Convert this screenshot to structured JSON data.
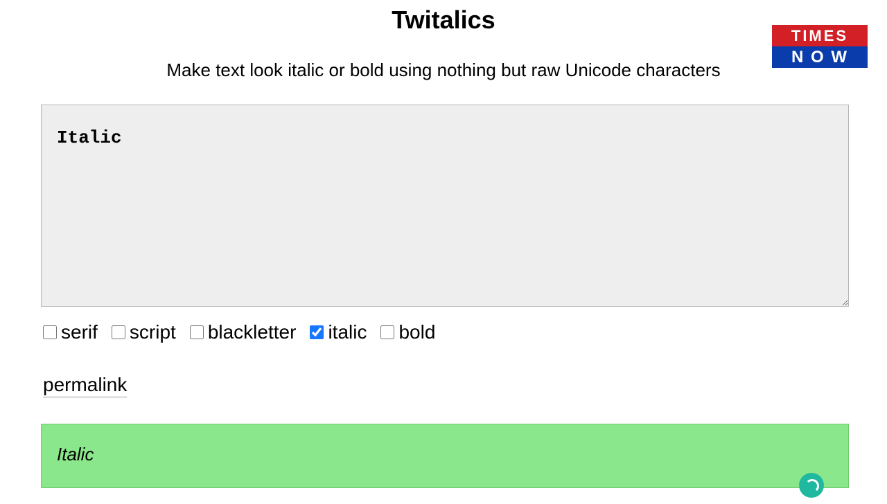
{
  "header": {
    "title": "Twitalics",
    "subtitle": "Make text look italic or bold using nothing but raw Unicode characters"
  },
  "logo": {
    "line1": "TIMES",
    "line2": "N O W"
  },
  "input": {
    "value": "Italic"
  },
  "options": {
    "serif": {
      "label": "serif",
      "checked": false
    },
    "script": {
      "label": "script",
      "checked": false
    },
    "blackletter": {
      "label": "blackletter",
      "checked": false
    },
    "italic": {
      "label": "italic",
      "checked": true
    },
    "bold": {
      "label": "bold",
      "checked": false
    }
  },
  "permalink": {
    "label": "permalink"
  },
  "output": {
    "text": "Italic"
  }
}
